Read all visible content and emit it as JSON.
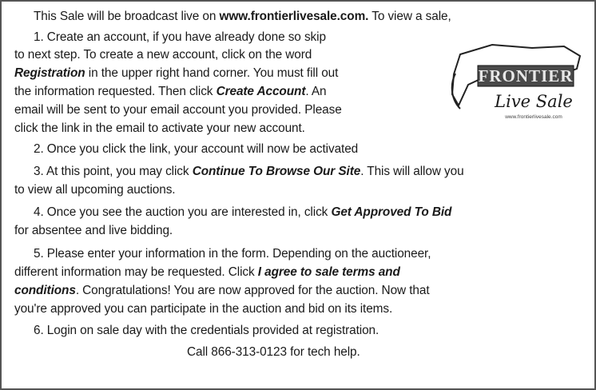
{
  "intro": {
    "pre": "This Sale will be broadcast live on ",
    "url": "www.frontierlivesale.com.",
    "post": "  To view a sale,"
  },
  "step1": {
    "l1": "1. Create an account, if you have already done so skip",
    "l2": "to next step.  To create a new account, click on the word",
    "l3_em": "Registration",
    "l3_rest": " in the upper right hand corner.  You must fill out",
    "l4_pre": "the information requested.  Then click ",
    "l4_em": "Create Account",
    "l4_post": ".  An",
    "l5": "email will be sent to your email account you provided.  Please",
    "l6": "click the link in the email to activate your new account."
  },
  "step2": {
    "l1": "2. Once you click the link, your account will now be activated"
  },
  "step3": {
    "l1_pre": "3. At this point, you may click ",
    "l1_em": "Continue To Browse Our Site",
    "l1_post": ".  This will allow you",
    "l2": "to view all upcoming auctions."
  },
  "step4": {
    "l1_pre": "4. Once you see the auction you are interested in, click ",
    "l1_em": "Get Approved To Bid",
    "l2": "for absentee and live bidding."
  },
  "step5": {
    "l1": "5. Please enter your information in the form.  Depending on the auctioneer,",
    "l2_pre": "different information may be requested.  Click ",
    "l2_em": "I agree to sale terms and",
    "l3_em": "conditions",
    "l3_post": ".  Congratulations!  You are now approved for the auction.  Now that",
    "l4": "you're approved you can participate in the auction and bid on its items."
  },
  "step6": {
    "l1": "6. Login on sale day with the credentials provided at registration."
  },
  "footer": {
    "help": "Call 866-313-0123 for tech help."
  },
  "logo": {
    "word1": "FRONTIER",
    "word2": "Live Sale",
    "url": "www.frontierlivesale.com"
  }
}
